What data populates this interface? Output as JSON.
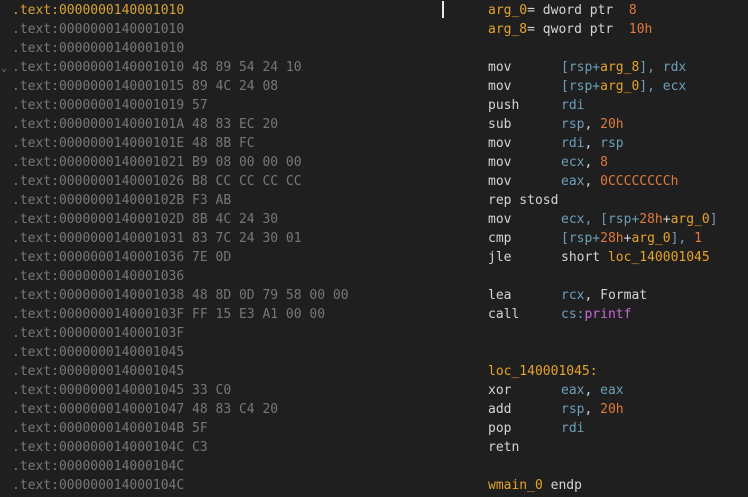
{
  "listing": {
    "address_lines": [
      {
        "addr": ".text:0000000140001010",
        "bytes": "",
        "active": true
      },
      {
        "addr": ".text:0000000140001010",
        "bytes": ""
      },
      {
        "addr": ".text:0000000140001010",
        "bytes": ""
      },
      {
        "addr": ".text:0000000140001010",
        "bytes": "48 89 54 24 10"
      },
      {
        "addr": ".text:0000000140001015",
        "bytes": "89 4C 24 08"
      },
      {
        "addr": ".text:0000000140001019",
        "bytes": "57"
      },
      {
        "addr": ".text:000000014000101A",
        "bytes": "48 83 EC 20"
      },
      {
        "addr": ".text:000000014000101E",
        "bytes": "48 8B FC"
      },
      {
        "addr": ".text:0000000140001021",
        "bytes": "B9 08 00 00 00"
      },
      {
        "addr": ".text:0000000140001026",
        "bytes": "B8 CC CC CC CC"
      },
      {
        "addr": ".text:000000014000102B",
        "bytes": "F3 AB"
      },
      {
        "addr": ".text:000000014000102D",
        "bytes": "8B 4C 24 30"
      },
      {
        "addr": ".text:0000000140001031",
        "bytes": "83 7C 24 30 01"
      },
      {
        "addr": ".text:0000000140001036",
        "bytes": "7E 0D"
      },
      {
        "addr": ".text:0000000140001036",
        "bytes": ""
      },
      {
        "addr": ".text:0000000140001038",
        "bytes": "48 8D 0D 79 58 00 00"
      },
      {
        "addr": ".text:000000014000103F",
        "bytes": "FF 15 E3 A1 00 00"
      },
      {
        "addr": ".text:000000014000103F",
        "bytes": ""
      },
      {
        "addr": ".text:0000000140001045",
        "bytes": ""
      },
      {
        "addr": ".text:0000000140001045",
        "bytes": ""
      },
      {
        "addr": ".text:0000000140001045",
        "bytes": "33 C0"
      },
      {
        "addr": ".text:0000000140001047",
        "bytes": "48 83 C4 20"
      },
      {
        "addr": ".text:000000014000104B",
        "bytes": "5F"
      },
      {
        "addr": ".text:000000014000104C",
        "bytes": "C3"
      },
      {
        "addr": ".text:000000014000104C",
        "bytes": ""
      },
      {
        "addr": ".text:000000014000104C",
        "bytes": ""
      }
    ],
    "gutter_mark": "⌄"
  },
  "disasm": {
    "arg0_decl": {
      "name": "arg_0",
      "eq": "=",
      "type": "dword ptr",
      "value": "8"
    },
    "arg8_decl": {
      "name": "arg_8",
      "eq": "=",
      "type": "qword ptr",
      "value": "10h"
    },
    "i1": {
      "mnem": "mov",
      "a": "[rsp+",
      "b": "arg_8",
      "c": "], ",
      "d": "rdx"
    },
    "i2": {
      "mnem": "mov",
      "a": "[rsp+",
      "b": "arg_0",
      "c": "], ",
      "d": "ecx"
    },
    "i3": {
      "mnem": "push",
      "a": "rdi"
    },
    "i4": {
      "mnem": "sub",
      "a": "rsp",
      "b": ", ",
      "c": "20h"
    },
    "i5": {
      "mnem": "mov",
      "a": "rdi",
      "b": ", ",
      "c": "rsp"
    },
    "i6": {
      "mnem": "mov",
      "a": "ecx",
      "b": ", ",
      "c": "8"
    },
    "i7": {
      "mnem": "mov",
      "a": "eax",
      "b": ", ",
      "c": "0CCCCCCCCh"
    },
    "i8": {
      "text": "rep stosd"
    },
    "i9": {
      "mnem": "mov",
      "a": "ecx",
      "b": ", [rsp+",
      "c": "28h",
      "d": "+",
      "e": "arg_0",
      "f": "]"
    },
    "i10": {
      "mnem": "cmp",
      "a": "[rsp+",
      "b": "28h",
      "c": "+",
      "d": "arg_0",
      "e": "], ",
      "f": "1"
    },
    "i11": {
      "mnem": "jle",
      "a": "short ",
      "b": "loc_140001045"
    },
    "i12": {
      "mnem": "lea",
      "a": "rcx",
      "b": ", Format"
    },
    "i13": {
      "mnem": "call",
      "a": "cs:",
      "b": "printf"
    },
    "label": "loc_140001045:",
    "i14": {
      "mnem": "xor",
      "a": "eax",
      "b": ", ",
      "c": "eax"
    },
    "i15": {
      "mnem": "add",
      "a": "rsp",
      "b": ", ",
      "c": "20h"
    },
    "i16": {
      "mnem": "pop",
      "a": "rdi"
    },
    "i17": {
      "text": "retn"
    },
    "endp": {
      "name": "wmain_0",
      "kw": " endp"
    }
  }
}
